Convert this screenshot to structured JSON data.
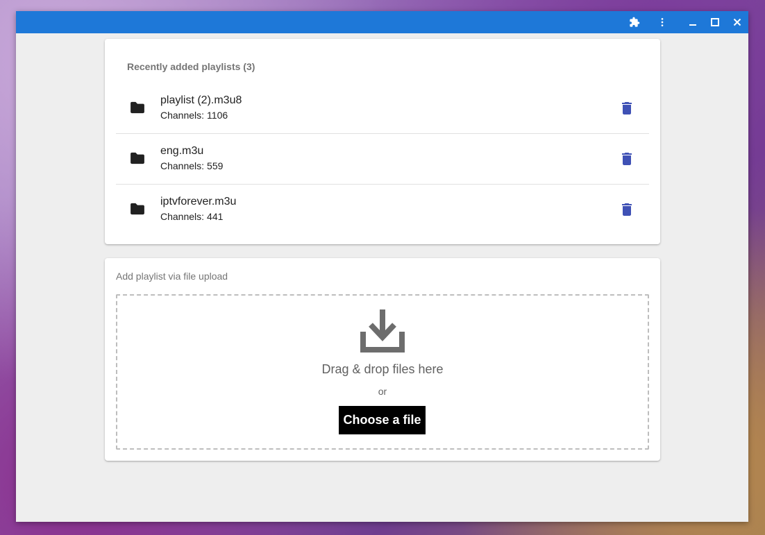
{
  "window": {
    "titlebar_color": "#1e78d8",
    "controls": [
      {
        "name": "extensions-icon"
      },
      {
        "name": "more-vert-icon"
      },
      {
        "name": "minimize-icon"
      },
      {
        "name": "maximize-icon"
      },
      {
        "name": "close-icon"
      }
    ]
  },
  "playlists": {
    "header": "Recently added playlists (3)",
    "channels_label": "Channels:",
    "items": [
      {
        "title": "playlist (2).m3u8",
        "channels": "1106",
        "icon": "folder-icon",
        "action_icon": "delete-icon"
      },
      {
        "title": "eng.m3u",
        "channels": "559",
        "icon": "folder-icon",
        "action_icon": "delete-icon"
      },
      {
        "title": "iptvforever.m3u",
        "channels": "441",
        "icon": "folder-icon",
        "action_icon": "delete-icon"
      }
    ],
    "delete_color": "#3f51b5"
  },
  "upload": {
    "header": "Add playlist via file upload",
    "drop_text": "Drag & drop files here",
    "or_text": "or",
    "button_label": "Choose a file",
    "icon": "download-icon"
  }
}
